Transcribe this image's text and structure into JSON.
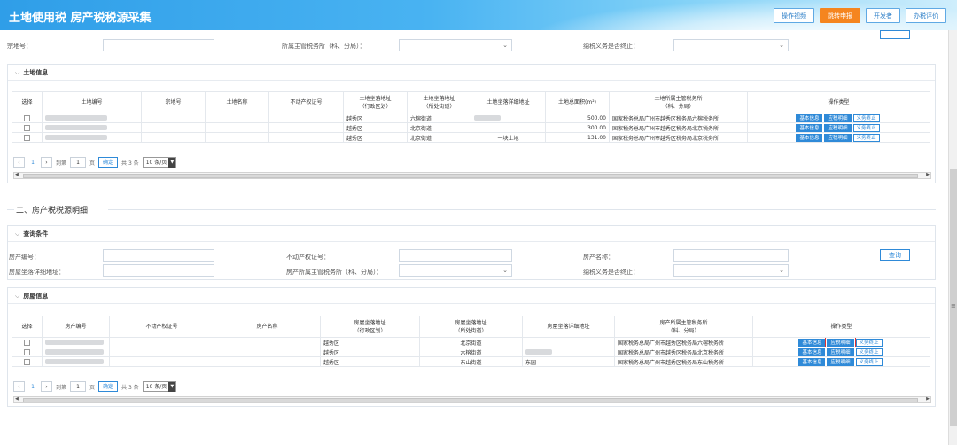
{
  "header": {
    "title": "土地使用税 房产税税源采集",
    "buttons": [
      "操作视频",
      "跳转申报",
      "开发者",
      "办税评价"
    ]
  },
  "land_query_partial": {
    "field1": "宗地号：",
    "field2": "所属主管税务所（科、分局）：",
    "field3": "纳税义务是否终止："
  },
  "land_panel": {
    "title": "土地信息",
    "columns": [
      "选择",
      "土地编号",
      "宗地号",
      "土地名称",
      "不动产权证号",
      "土地坐落地址\n（行政区划）",
      "土地坐落地址\n（所处街道）",
      "土地坐落详细地址",
      "土地总面积(m²)",
      "土地所属主管税务所\n（科、分局）",
      "操作类型"
    ],
    "rows": [
      {
        "district": "越秀区",
        "street": "六榕街道",
        "detail": "",
        "area": "500.00",
        "office": "国家税务总局广州市越秀区税务局六榕税务所"
      },
      {
        "district": "越秀区",
        "street": "北京街道",
        "detail": "",
        "area": "300.00",
        "office": "国家税务总局广州市越秀区税务局北京税务所"
      },
      {
        "district": "越秀区",
        "street": "北京街道",
        "detail": "一块土地",
        "area": "131.00",
        "office": "国家税务总局广州市越秀区税务局北京税务所"
      }
    ],
    "actions": [
      "基本信息",
      "应税明细",
      "义务终止"
    ],
    "pager": {
      "page": "1",
      "goto_label": "到第",
      "goto_value": "1",
      "page_unit": "页",
      "confirm": "确定",
      "total": "共 3 条",
      "size": "10 条/页"
    }
  },
  "section2": {
    "title": "二、房产税税源明细"
  },
  "house_query": {
    "title": "查询条件",
    "house_no": "房产编号：",
    "cert_no": "不动产权证号：",
    "house_name": "房产名称：",
    "address": "房屋坐落详细地址：",
    "office": "房产所属主管税务所（科、分局）：",
    "terminated": "纳税义务是否终止：",
    "query_btn": "查询"
  },
  "house_panel": {
    "title": "房屋信息",
    "columns": [
      "选择",
      "房产编号",
      "不动产权证号",
      "房产名称",
      "房屋坐落地址\n（行政区划）",
      "房屋坐落地址\n（所处街道）",
      "房屋坐落详细地址",
      "房产所属主管税务所\n（科、分局）",
      "操作类型"
    ],
    "rows": [
      {
        "district": "越秀区",
        "street": "北京街道",
        "detail": "",
        "office": "国家税务总局广州市越秀区税务局六榕税务所"
      },
      {
        "district": "越秀区",
        "street": "六榕街道",
        "detail": "",
        "office": "国家税务总局广州市越秀区税务局北京税务所"
      },
      {
        "district": "越秀区",
        "street": "东山街道",
        "detail": "东园",
        "office": "国家税务总局广州市越秀区税务局东山税务所"
      }
    ],
    "actions": [
      "基本信息",
      "应税明细",
      "义务终止"
    ],
    "pager": {
      "page": "1",
      "goto_label": "到第",
      "goto_value": "1",
      "page_unit": "页",
      "confirm": "确定",
      "total": "共 3 条",
      "size": "10 条/页"
    }
  },
  "icons": {
    "chevron": "chevron-down-icon",
    "prev": "chevron-left-icon",
    "next": "chevron-right-icon"
  }
}
